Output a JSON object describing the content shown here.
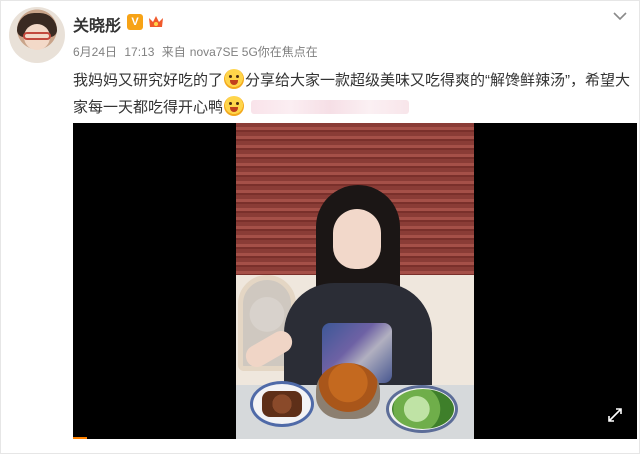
{
  "post": {
    "author": "关晓彤",
    "badge_letter": "V",
    "meta": {
      "date": "6月24日",
      "time": "17:13",
      "source_prefix": "来自",
      "source": "nova7SE 5G你在焦点在"
    },
    "text": {
      "part1": "我妈妈又研究好吃的了",
      "part2": "分享给大家一款超级美味又吃得爽的“解馋鲜辣汤”，希望大家每一天都吃得开心鸭"
    },
    "icons": {
      "menu": "chevron-down-icon",
      "fullscreen": "fullscreen-icon",
      "verified": "v-badge-icon",
      "member": "member-crown-icon",
      "emoji": "smile-emoji-icon"
    },
    "colors": {
      "badge": "#f7a316",
      "progress": "#ff8200",
      "meta_text": "#808080"
    }
  }
}
